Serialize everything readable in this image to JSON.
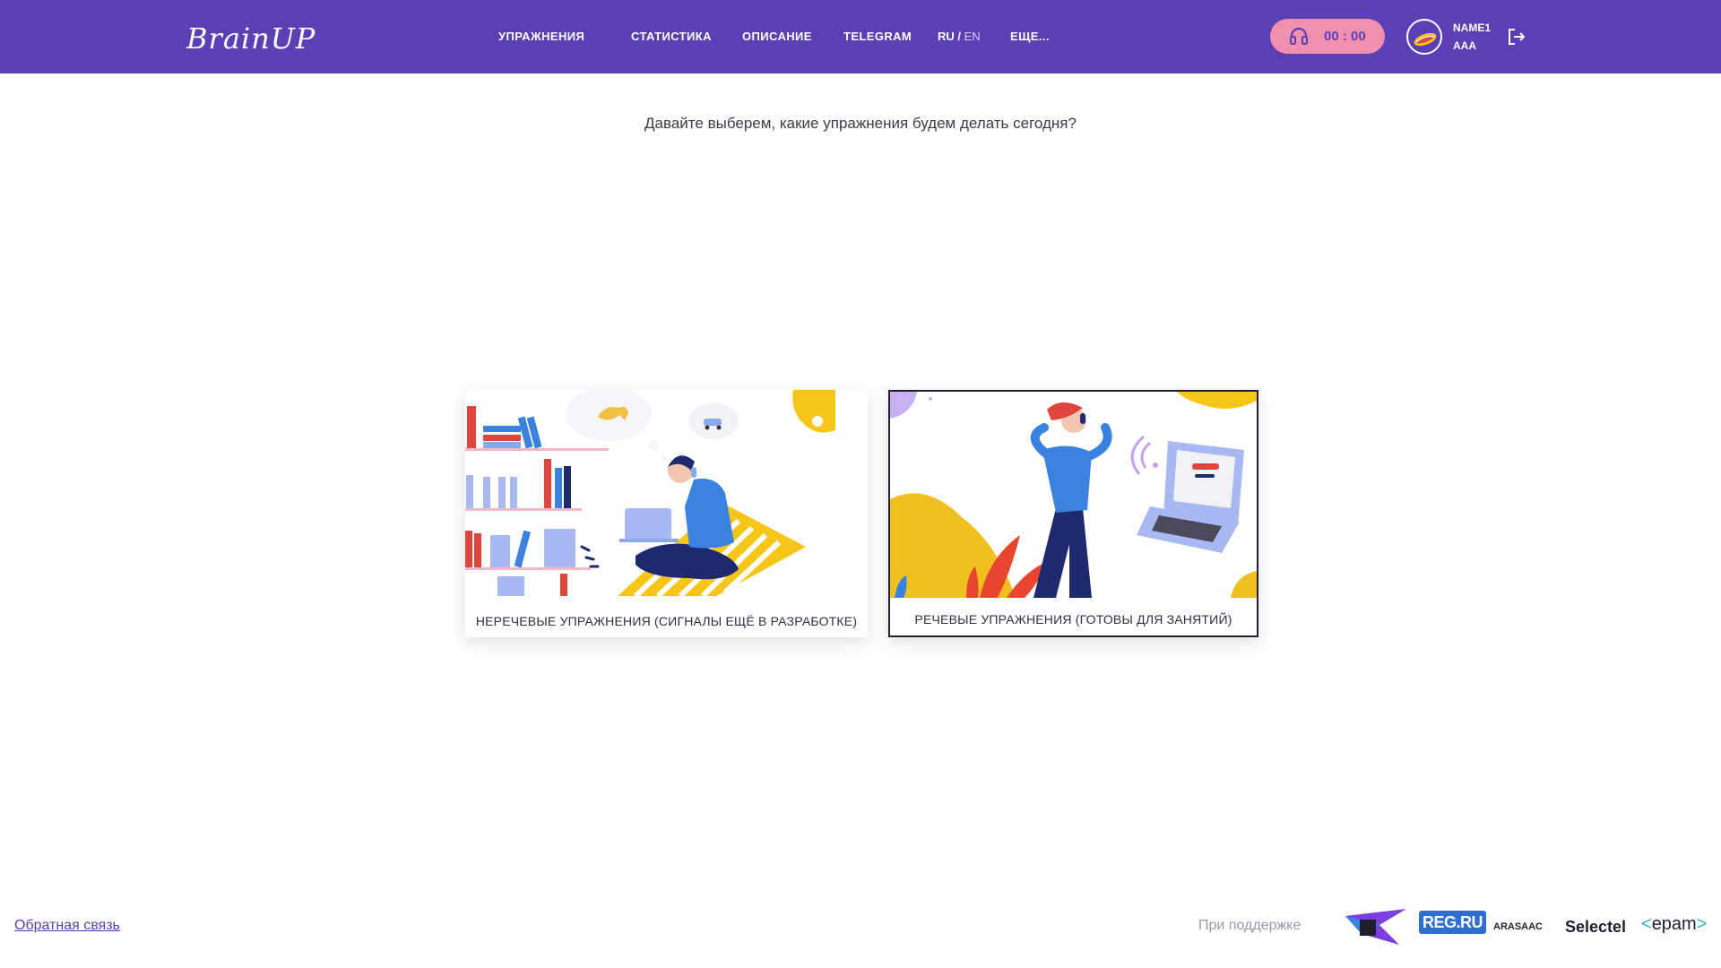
{
  "header": {
    "logo": "BrainUP",
    "nav": {
      "exercises": "УПРАЖНЕНИЯ",
      "statistics": "СТАТИСТИКА",
      "description": "ОПИСАНИЕ",
      "telegram": "TELEGRAM",
      "more": "ЕЩЕ..."
    },
    "lang": {
      "ru": "RU",
      "sep": " / ",
      "en": "EN"
    },
    "timer": "00 : 00",
    "user": {
      "name": "NAME1",
      "sub": "AAA"
    }
  },
  "main": {
    "subtitle": "Давайте выберем, какие упражнения будем делать сегодня?",
    "cards": [
      {
        "label": "НЕРЕЧЕВЫЕ УПРАЖНЕНИЯ (СИГНАЛЫ ЕЩЁ В РАЗРАБОТКЕ)"
      },
      {
        "label": "РЕЧЕВЫЕ УПРАЖНЕНИЯ (ГОТОВЫ ДЛЯ ЗАНЯТИЙ)"
      }
    ]
  },
  "footer": {
    "feedback": "Обратная связь",
    "support": "При поддержке",
    "sponsors": [
      "REG.RU",
      "ARASAAC",
      "Selectel",
      "epam"
    ]
  },
  "colors": {
    "header_bg": "#5b3fb5",
    "timer_bg": "#f08fae",
    "accent_yellow": "#f5c518",
    "accent_blue": "#3b82e0"
  }
}
